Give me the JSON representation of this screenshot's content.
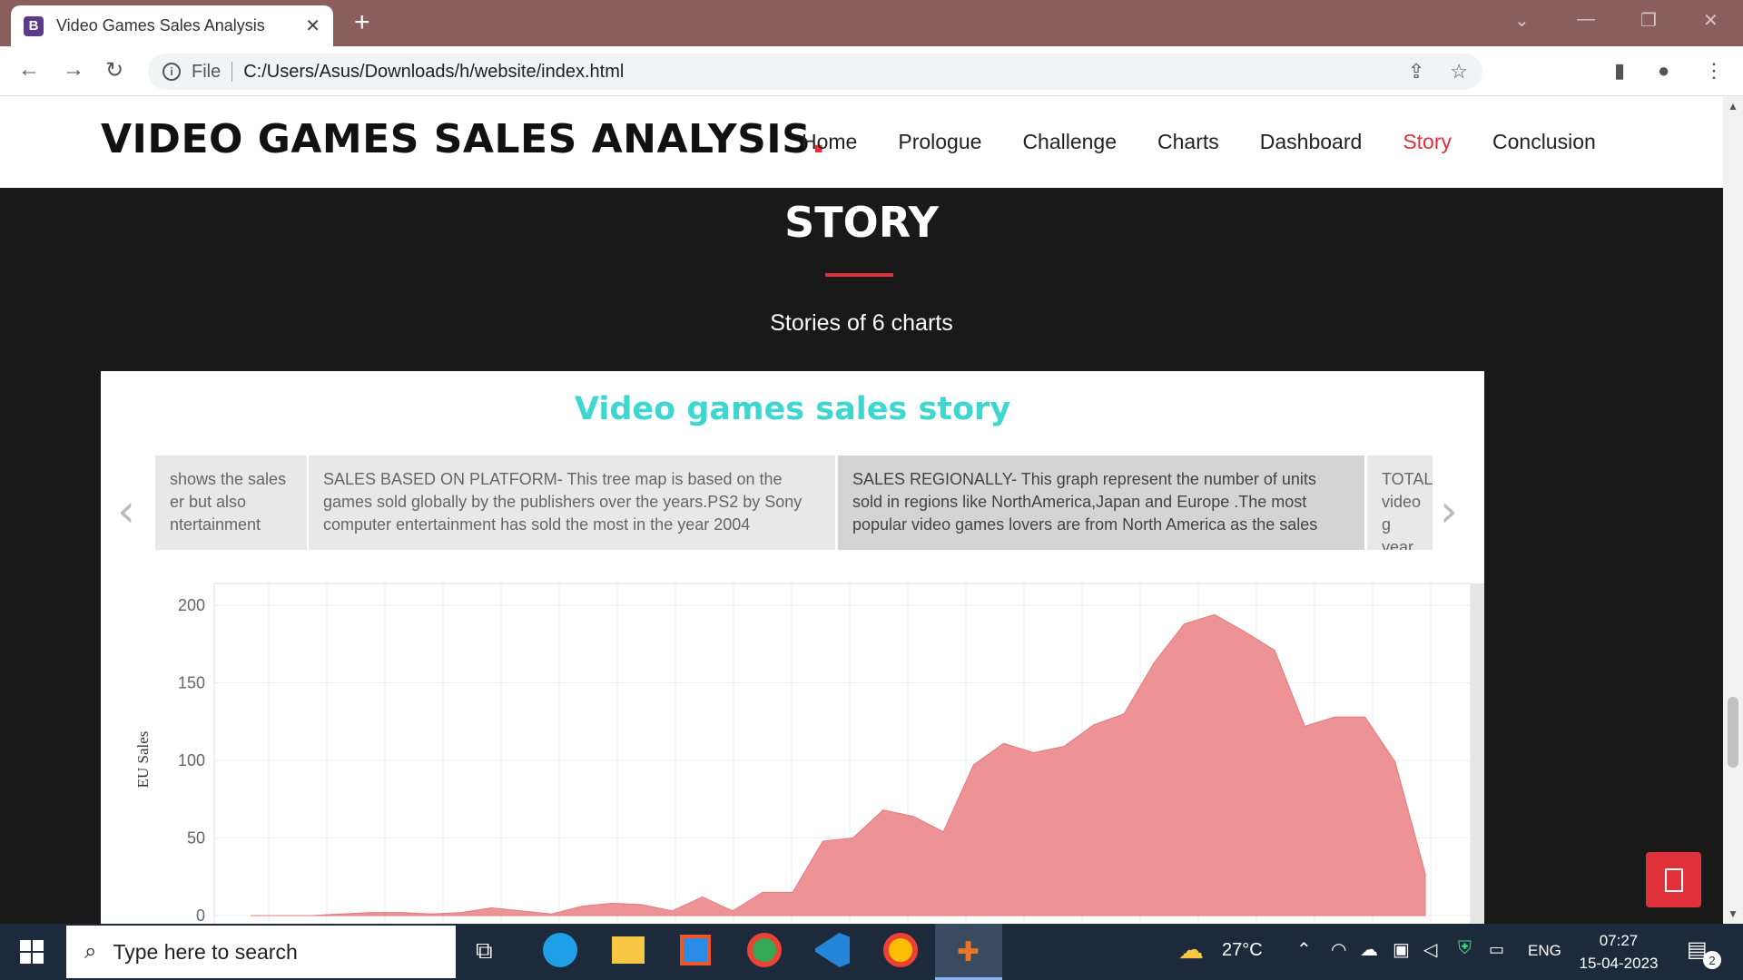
{
  "browser": {
    "tab_title": "Video Games Sales Analysis",
    "tab_icon": "B",
    "address": "C:/Users/Asus/Downloads/h/website/index.html",
    "address_prefix": "File"
  },
  "site": {
    "brand": "VIDEO GAMES SALES ANALYSIS",
    "brand_dot": ".",
    "nav": [
      {
        "label": "Home"
      },
      {
        "label": "Prologue"
      },
      {
        "label": "Challenge"
      },
      {
        "label": "Charts"
      },
      {
        "label": "Dashboard"
      },
      {
        "label": "Story",
        "active": true
      },
      {
        "label": "Conclusion"
      }
    ],
    "accent_color": "#e0313b"
  },
  "story": {
    "heading": "STORY",
    "subheading": "Stories of 6 charts",
    "panel_title": "Video games sales story",
    "points": [
      {
        "text": "shows the sales er but also ntertainment"
      },
      {
        "text": "SALES BASED ON PLATFORM-  This tree map is based on the games sold globally by the publishers over the years.PS2 by Sony computer entertainment has sold the most in the year 2004"
      },
      {
        "text": "SALES REGIONALLY- This graph represent the number of units sold in regions  like NorthAmerica,Japan and Europe .The most popular video games lovers are from North America as the sales"
      },
      {
        "text": "TOTAL video g year w"
      }
    ]
  },
  "chart_data": {
    "type": "area",
    "ylabel": "EU Sales",
    "xlabel": "",
    "ylim": [
      0,
      200
    ],
    "yticks": [
      0,
      50,
      100,
      150,
      200
    ],
    "color": "#ec8d90",
    "x": [
      1,
      2,
      3,
      4,
      5,
      6,
      7,
      8,
      9,
      10,
      11,
      12,
      13,
      14,
      15,
      16,
      17,
      18,
      19,
      20,
      21,
      22,
      23,
      24,
      25,
      26,
      27,
      28,
      29,
      30,
      31,
      32,
      33,
      34,
      35,
      36,
      37,
      38,
      39,
      40
    ],
    "values": [
      0,
      0,
      0,
      1,
      2,
      2,
      1,
      2,
      5,
      3,
      1,
      6,
      8,
      7,
      3,
      12,
      3,
      15,
      15,
      48,
      50,
      68,
      64,
      54,
      97,
      111,
      105,
      109,
      123,
      130,
      163,
      188,
      194,
      183,
      171,
      122,
      128,
      128,
      99,
      27
    ]
  },
  "taskbar": {
    "search_placeholder": "Type here to search",
    "weather": "27°C",
    "lang": "ENG",
    "time": "07:27",
    "date": "15-04-2023",
    "notif_count": "2"
  }
}
